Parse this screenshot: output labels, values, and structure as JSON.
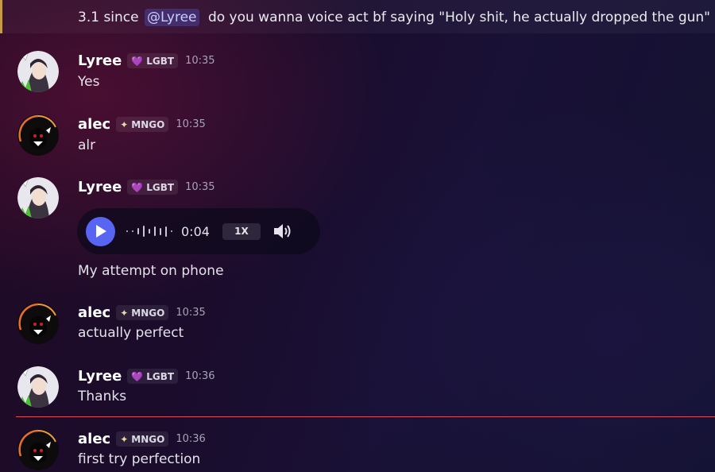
{
  "top_message": {
    "prefix": "3.1 since",
    "mention": "@Lyree",
    "suffix": "do you wanna voice act bf saying \"Holy shit, he actually dropped the gun\""
  },
  "messages": [
    {
      "username": "Lyree",
      "tag": "LGBT",
      "tag_icon": "heart-icon",
      "time": "10:35",
      "text": "Yes"
    },
    {
      "username": "alec",
      "tag": "MNGO",
      "tag_icon": "sparkle-icon",
      "time": "10:35",
      "text": "alr"
    },
    {
      "username": "Lyree",
      "tag": "LGBT",
      "tag_icon": "heart-icon",
      "time": "10:35",
      "text": "My attempt on phone"
    },
    {
      "username": "alec",
      "tag": "MNGO",
      "tag_icon": "sparkle-icon",
      "time": "10:35",
      "text": "actually perfect"
    },
    {
      "username": "Lyree",
      "tag": "LGBT",
      "tag_icon": "heart-icon",
      "time": "10:36",
      "text": "Thanks"
    },
    {
      "username": "alec",
      "tag": "MNGO",
      "tag_icon": "sparkle-icon",
      "time": "10:36",
      "text": "first try perfection"
    }
  ],
  "voice_message": {
    "duration": "0:04",
    "speed": "1X",
    "play_icon": "play-icon",
    "volume_icon": "speaker-icon"
  },
  "colors": {
    "accent": "#5865f2",
    "mention_bar": "#c79a44",
    "new_messages_divider": "#d9515e"
  }
}
